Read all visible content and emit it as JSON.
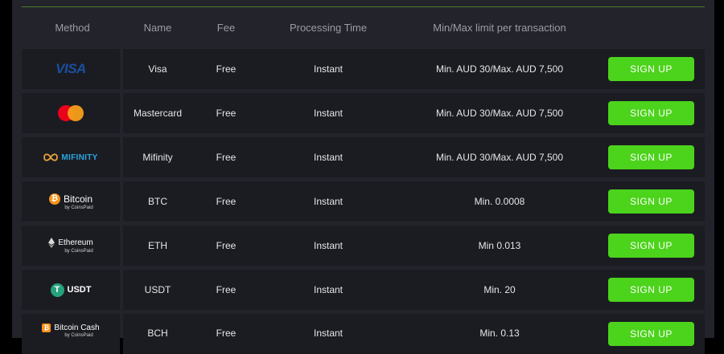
{
  "header": {
    "method": "Method",
    "name": "Name",
    "fee": "Fee",
    "processing_time": "Processing Time",
    "limits": "Min/Max limit per transaction"
  },
  "rows": [
    {
      "logo": {
        "text": "VISA"
      },
      "name": "Visa",
      "fee": "Free",
      "time": "Instant",
      "limit": "Min. AUD 30/Max. AUD 7,500",
      "button": "SIGN UP"
    },
    {
      "logo": {
        "icon": "mastercard-icon"
      },
      "name": "Mastercard",
      "fee": "Free",
      "time": "Instant",
      "limit": "Min. AUD 30/Max. AUD 7,500",
      "button": "SIGN UP"
    },
    {
      "logo": {
        "text": "MIFINITY"
      },
      "name": "Mifinity",
      "fee": "Free",
      "time": "Instant",
      "limit": "Min. AUD 30/Max. AUD 7,500",
      "button": "SIGN UP"
    },
    {
      "logo": {
        "text": "Bitcoin",
        "sub": "by CoinsPaid"
      },
      "name": "BTC",
      "fee": "Free",
      "time": "Instant",
      "limit": "Min. 0.0008",
      "button": "SIGN UP"
    },
    {
      "logo": {
        "text": "Ethereum",
        "sub": "by CoinsPaid"
      },
      "name": "ETH",
      "fee": "Free",
      "time": "Instant",
      "limit": "Min 0.013",
      "button": "SIGN UP"
    },
    {
      "logo": {
        "text": "USDT"
      },
      "name": "USDT",
      "fee": "Free",
      "time": "Instant",
      "limit": "Min. 20",
      "button": "SIGN UP"
    },
    {
      "logo": {
        "text": "Bitcoin Cash",
        "sub": "by CoinsPaid"
      },
      "name": "BCH",
      "fee": "Free",
      "time": "Instant",
      "limit": "Min. 0.13",
      "button": "SIGN UP"
    }
  ],
  "colors": {
    "accent_button": "#4cd31b",
    "background": "#23242b",
    "row_background": "#1b1c22"
  }
}
